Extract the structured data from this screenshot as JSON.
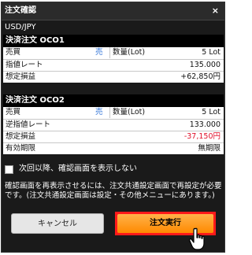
{
  "dialog": {
    "title": "注文確認",
    "close_label": "×",
    "pair": "USD/JPY"
  },
  "settlement_oco1": {
    "header": "決済注文 OCO1",
    "rows": [
      {
        "label": "売買",
        "side": "売",
        "label2": "数量(Lot)",
        "value": "5 Lot"
      },
      {
        "label": "指値レート",
        "value": "135.000"
      },
      {
        "label": "想定損益",
        "value": "+62,850円"
      }
    ]
  },
  "settlement_oco2": {
    "header": "決済注文 OCO2",
    "rows": [
      {
        "label": "売買",
        "side": "売",
        "label2": "数量(Lot)",
        "value": "5 Lot"
      },
      {
        "label": "逆指値レート",
        "value": "133.000"
      },
      {
        "label": "想定損益",
        "value": "-37,150円"
      },
      {
        "label": "有効期限",
        "value": "無期限"
      }
    ]
  },
  "confirm_option": {
    "label": "次回以降、確認画面を表示しない",
    "checked": false
  },
  "note": {
    "text": "確認画面を再表示させるには、注文共通設定画面で再設定が必要です。(注文共通設定画面は設定・その他メニューにあります。)"
  },
  "buttons": {
    "cancel": "キャンセル",
    "execute": "注文実行"
  },
  "colors": {
    "dialog_bg": "#1a1a1a",
    "side_sell": "#2a6fd6",
    "loss": "#e0102a",
    "execute_bg": "#ff8a00",
    "highlight": "#ff1a1a"
  },
  "icons": {
    "close": "close-icon",
    "cursor": "hand-pointer-icon"
  }
}
